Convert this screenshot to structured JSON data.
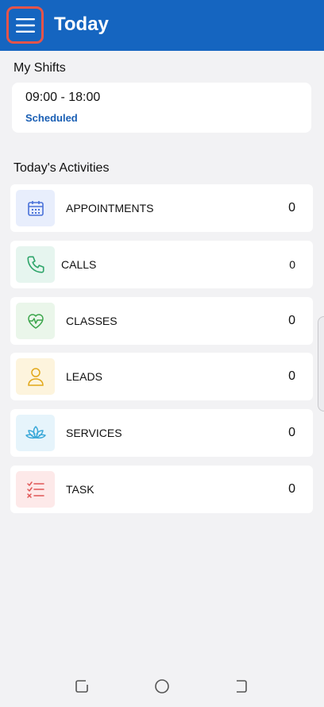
{
  "appbar": {
    "title": "Today",
    "menu_icon": "hamburger-menu-icon"
  },
  "shifts": {
    "title": "My Shifts",
    "items": [
      {
        "time": "09:00 - 18:00",
        "status": "Scheduled"
      }
    ]
  },
  "activities": {
    "title": "Today's Activities",
    "items": [
      {
        "label": "APPOINTMENTS",
        "count": "0",
        "icon": "calendar-icon",
        "icon_bg": "#e8eefc",
        "icon_color": "#4a72d9"
      },
      {
        "label": "CALLS",
        "count": "0",
        "icon": "phone-icon",
        "icon_bg": "#e6f5ef",
        "icon_color": "#2fa56b"
      },
      {
        "label": "CLASSES",
        "count": "0",
        "icon": "heart-pulse-icon",
        "icon_bg": "#eaf6ea",
        "icon_color": "#3aa54a"
      },
      {
        "label": "LEADS",
        "count": "0",
        "icon": "person-icon",
        "icon_bg": "#fdf4dd",
        "icon_color": "#e2a81a"
      },
      {
        "label": "SERVICES",
        "count": "0",
        "icon": "lotus-icon",
        "icon_bg": "#e6f4fb",
        "icon_color": "#3aa8d8"
      },
      {
        "label": "TASK",
        "count": "0",
        "icon": "checklist-icon",
        "icon_bg": "#fde9e9",
        "icon_color": "#e05757"
      }
    ]
  },
  "colors": {
    "appbar": "#1565c0",
    "status": "#1a5fb4",
    "highlight": "#e4544a"
  },
  "navbar": {
    "icons": [
      "recent-apps-icon",
      "home-icon",
      "back-icon"
    ]
  }
}
